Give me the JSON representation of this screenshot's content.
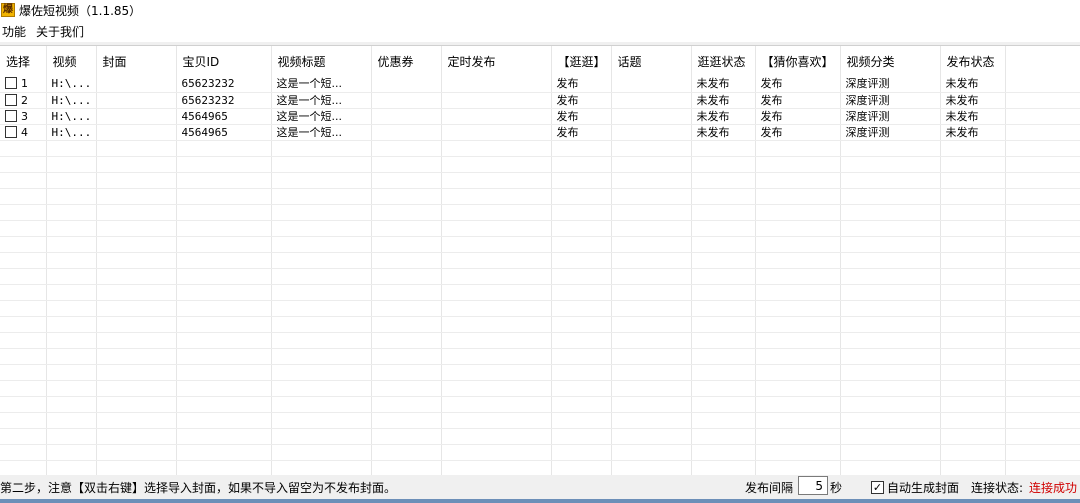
{
  "window": {
    "title": "爆佐短视频（1.1.85）",
    "icon_text": "爆"
  },
  "menu": {
    "items": [
      {
        "label": "功能"
      },
      {
        "label": "关于我们"
      }
    ]
  },
  "table": {
    "columns": [
      "选择",
      "视频",
      "封面",
      "宝贝ID",
      "视频标题",
      "优惠券",
      "定时发布",
      "【逛逛】",
      "话题",
      "逛逛状态",
      "【猜你喜欢】",
      "视频分类",
      "发布状态"
    ],
    "rows": [
      {
        "index": "1",
        "checked": false,
        "video": "H:\\...",
        "cover": "",
        "item_id": "65623232",
        "title": "这是一个短...",
        "coupon": "",
        "schedule": "",
        "guangguang": "发布",
        "topic": "",
        "gg_status": "未发布",
        "cai": "发布",
        "category": "深度评测",
        "pub_status": "未发布"
      },
      {
        "index": "2",
        "checked": false,
        "video": "H:\\...",
        "cover": "",
        "item_id": "65623232",
        "title": "这是一个短...",
        "coupon": "",
        "schedule": "",
        "guangguang": "发布",
        "topic": "",
        "gg_status": "未发布",
        "cai": "发布",
        "category": "深度评测",
        "pub_status": "未发布"
      },
      {
        "index": "3",
        "checked": false,
        "video": "H:\\...",
        "cover": "",
        "item_id": "4564965",
        "title": "这是一个短...",
        "coupon": "",
        "schedule": "",
        "guangguang": "发布",
        "topic": "",
        "gg_status": "未发布",
        "cai": "发布",
        "category": "深度评测",
        "pub_status": "未发布"
      },
      {
        "index": "4",
        "checked": false,
        "video": "H:\\...",
        "cover": "",
        "item_id": "4564965",
        "title": "这是一个短...",
        "coupon": "",
        "schedule": "",
        "guangguang": "发布",
        "topic": "",
        "gg_status": "未发布",
        "cai": "发布",
        "category": "深度评测",
        "pub_status": "未发布"
      }
    ]
  },
  "status": {
    "message": "第二步，注意【双击右键】选择导入封面，如果不导入留空为不发布封面。",
    "interval_label": "发布间隔",
    "interval_value": "5",
    "seconds_label": "秒",
    "auto_cover_label": "自动生成封面",
    "auto_cover_checked": true,
    "connection_label": "连接状态:",
    "connection_value": "连接成功",
    "connection_color": "#d00000"
  }
}
